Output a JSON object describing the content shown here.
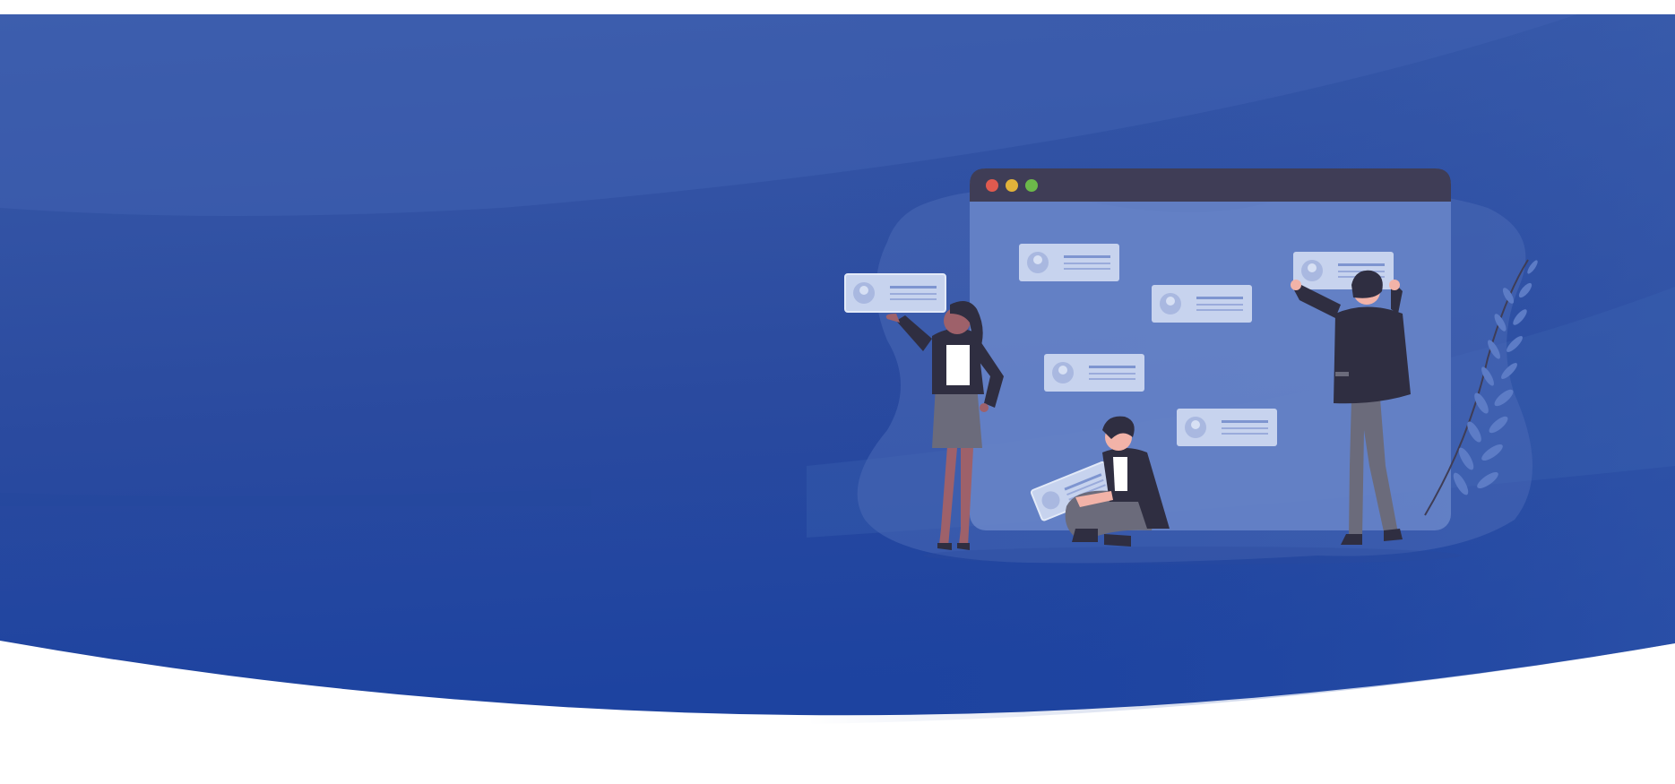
{
  "colors": {
    "hero_top": "#3659a8",
    "hero_bottom": "#1d43a0",
    "hero_light": "#4063b2",
    "window_titlebar": "#3f3d56",
    "window_body": "#6a86c9",
    "card": "#c7d3ee",
    "card_line": "#7e95d0",
    "dot_red": "#e05a4f",
    "dot_yellow": "#e1b33a",
    "dot_green": "#6cb94a",
    "suit_dark": "#2f2e41",
    "skin_dark": "#9e616a",
    "skin_light": "#f2b3a8",
    "pants_gray": "#6b6b7b",
    "shirt_white": "#ffffff",
    "plant": "#5d7cc6"
  },
  "icons": {
    "window_close": "red-dot-icon",
    "window_minimize": "yellow-dot-icon",
    "window_maximize": "green-dot-icon",
    "profile": "user-avatar-icon",
    "plant": "laurel-branch-icon"
  }
}
